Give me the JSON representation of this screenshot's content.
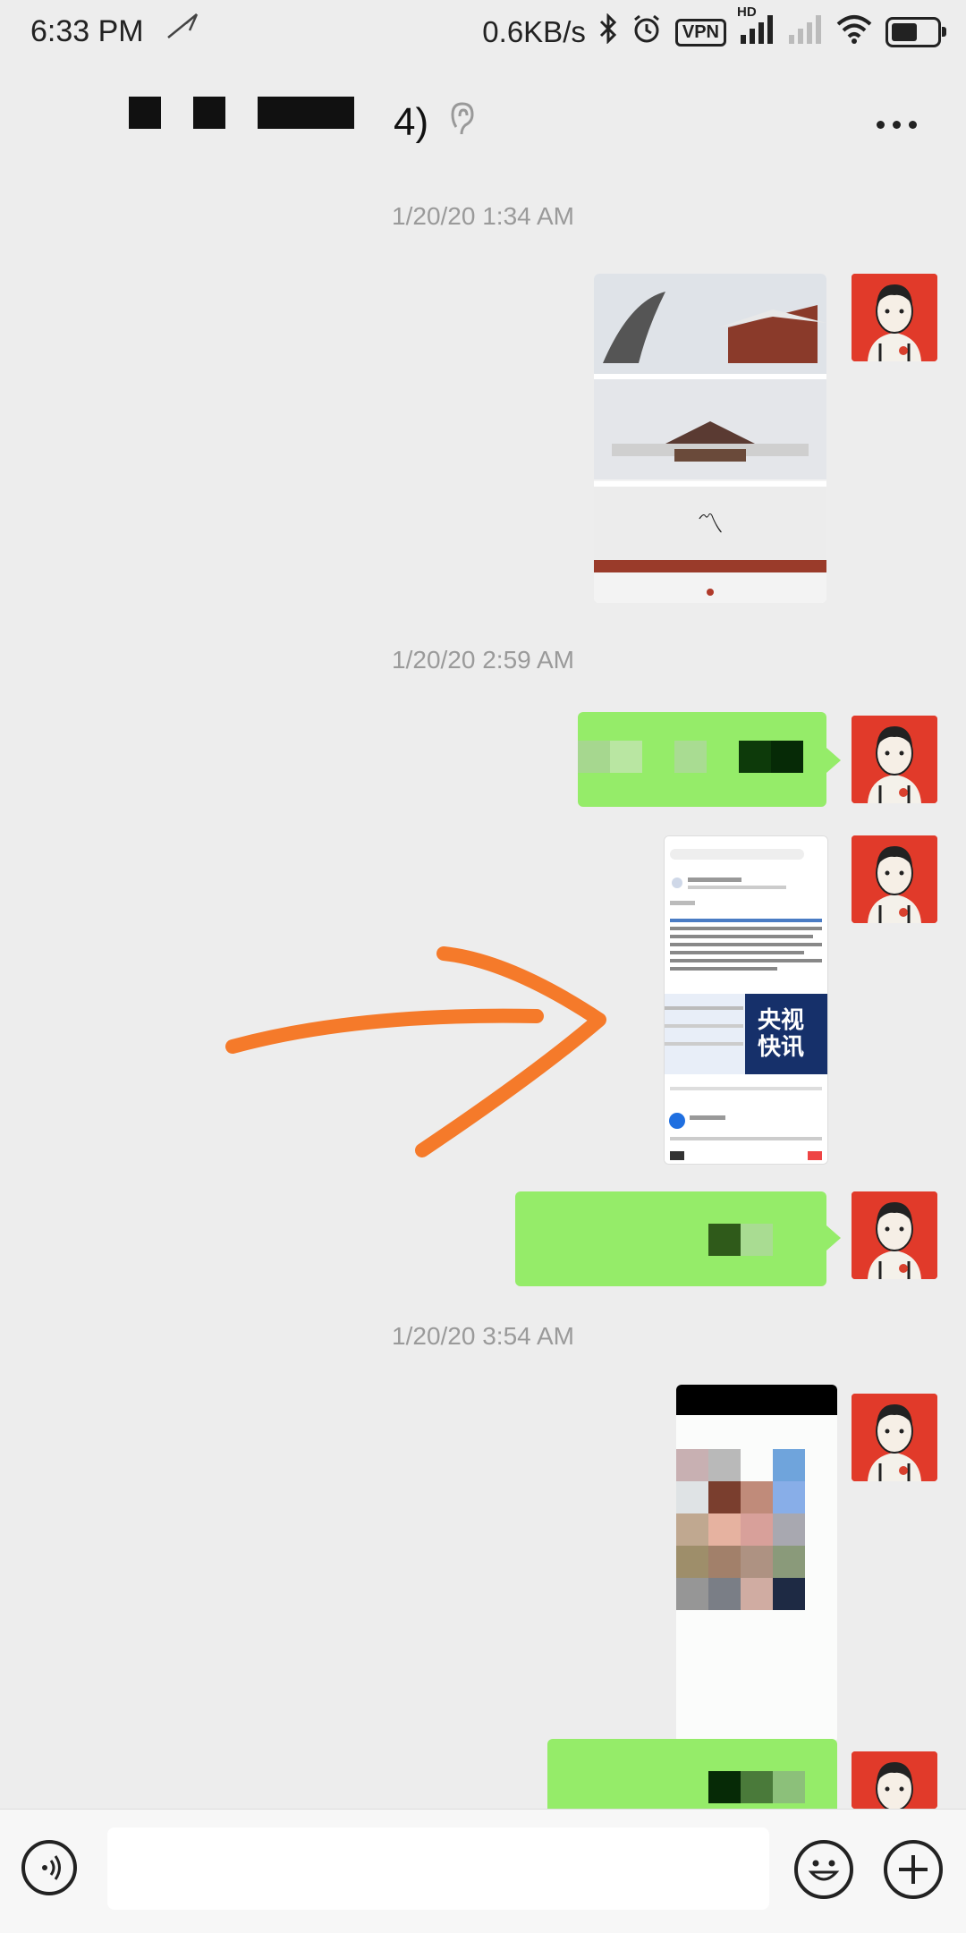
{
  "status_bar": {
    "time": "6:33 PM",
    "net_speed": "0.6KB/s",
    "vpn_label": "VPN",
    "hd_label": "HD",
    "icons": [
      "send-arrow-icon",
      "bluetooth-icon",
      "alarm-icon",
      "vpn-icon",
      "signal-icon",
      "signal-weak-icon",
      "wifi-icon",
      "battery-icon"
    ]
  },
  "header": {
    "title_suffix": "4)",
    "icons": [
      "ear-icon",
      "more-icon"
    ]
  },
  "timestamps": [
    "1/20/20 1:34 AM",
    "1/20/20 2:59 AM",
    "1/20/20 3:54 AM"
  ],
  "screenshot_thumb": {
    "news_title_line1": "央视",
    "news_title_line2": "快讯"
  },
  "colors": {
    "background": "#ededed",
    "bubble_green": "#95ec69",
    "annotation_orange": "#f57a2a",
    "avatar_red": "#e13a2a"
  },
  "bottom_bar": {
    "icons": [
      "voice-icon",
      "emoji-icon",
      "plus-icon"
    ]
  }
}
